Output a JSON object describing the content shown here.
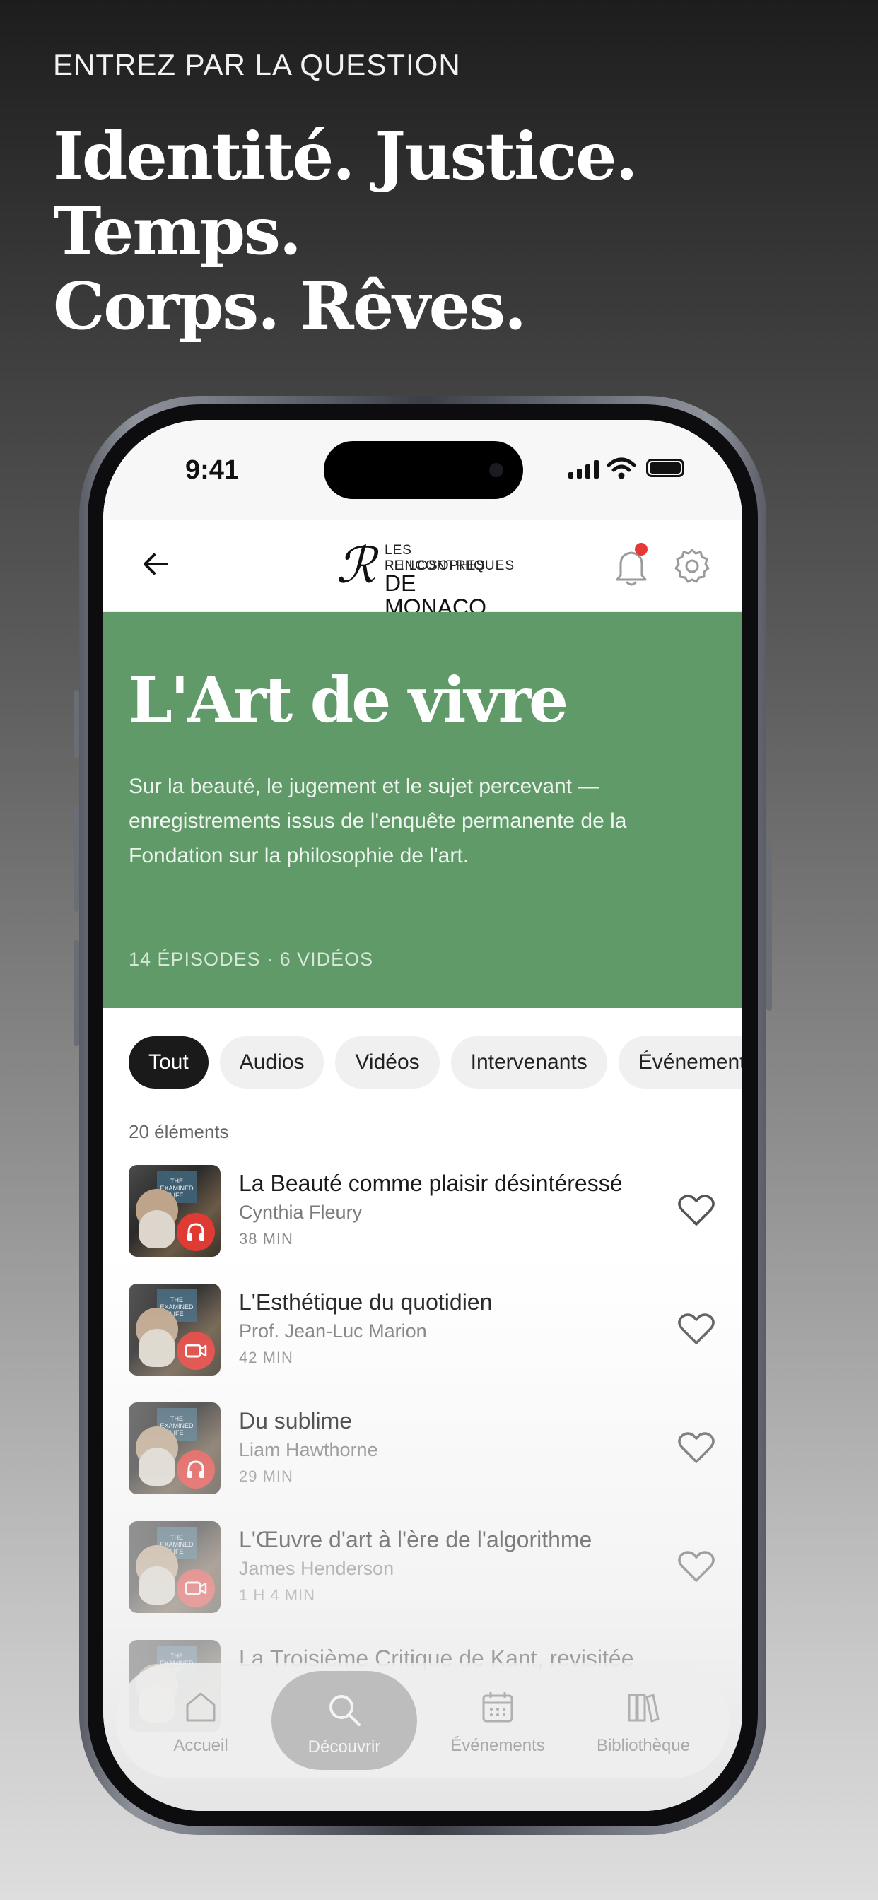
{
  "promo": {
    "kicker": "ENTREZ PAR LA QUESTION",
    "headline_line1": "Identité. Justice. Temps.",
    "headline_line2": "Corps. Rêves."
  },
  "status_bar": {
    "time": "9:41"
  },
  "app_bar": {
    "logo_mark": "ℛ",
    "logo_line1": "LES RENCONTRES",
    "logo_line2": "PHILOSOPHIQUES",
    "logo_line3": "DE MONACO",
    "notification_dot_color": "#e53935"
  },
  "hero": {
    "title": "L'Art de vivre",
    "description": "Sur la beauté, le jugement et le sujet percevant — enregistrements issus de l'enquête permanente de la Fondation sur la philosophie de l'art.",
    "meta": "14 ÉPISODES · 6 VIDÉOS",
    "color": "#5f9a68"
  },
  "filters": [
    {
      "label": "Tout",
      "active": true
    },
    {
      "label": "Audios",
      "active": false
    },
    {
      "label": "Vidéos",
      "active": false
    },
    {
      "label": "Intervenants",
      "active": false
    },
    {
      "label": "Événements",
      "active": false
    }
  ],
  "list_count": "20 éléments",
  "thumbnail_text": "THE EXAMINED LIFE",
  "items": [
    {
      "title": "La Beauté comme plaisir désintéressé",
      "speaker": "Cynthia Fleury",
      "duration": "38 MIN",
      "media": "headphones-icon"
    },
    {
      "title": "L'Esthétique du quotidien",
      "speaker": "Prof. Jean-Luc Marion",
      "duration": "42 MIN",
      "media": "video-icon"
    },
    {
      "title": "Du sublime",
      "speaker": "Liam Hawthorne",
      "duration": "29 MIN",
      "media": "headphones-icon"
    },
    {
      "title": "L'Œuvre d'art à l'ère de l'algorithme",
      "speaker": "James Henderson",
      "duration": "1 H 4 MIN",
      "media": "video-icon"
    },
    {
      "title": "La Troisième Critique de Kant, revisitée",
      "speaker": "",
      "duration": "",
      "media": "headphones-icon"
    }
  ],
  "tabs": [
    {
      "label": "Accueil",
      "icon": "home-icon",
      "active": false
    },
    {
      "label": "Découvrir",
      "icon": "search-icon",
      "active": true
    },
    {
      "label": "Événements",
      "icon": "calendar-icon",
      "active": false
    },
    {
      "label": "Bibliothèque",
      "icon": "library-icon",
      "active": false
    }
  ]
}
